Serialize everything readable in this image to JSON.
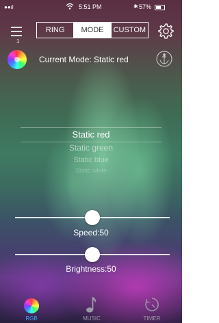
{
  "status_bar": {
    "time": "5:51 PM",
    "battery": "57%"
  },
  "menu": {
    "badge": "1"
  },
  "mode_tabs": [
    "RING",
    "MODE",
    "CUSTOM"
  ],
  "current_mode": "Current Mode: Static red",
  "mode_options": [
    "Static red",
    "Static green",
    "Static blue",
    "Static white"
  ],
  "sliders": {
    "speed": {
      "label": "Speed:50",
      "value": 50,
      "max": 100
    },
    "brightness": {
      "label": "Brightness:50",
      "value": 50,
      "max": 100
    }
  },
  "tabs": {
    "rgb": "RGB",
    "music": "MUSIC",
    "timer": "TIMER"
  },
  "colors": {
    "active_tab": "#3da7ff",
    "inactive_tab": "#9a9aa6"
  }
}
